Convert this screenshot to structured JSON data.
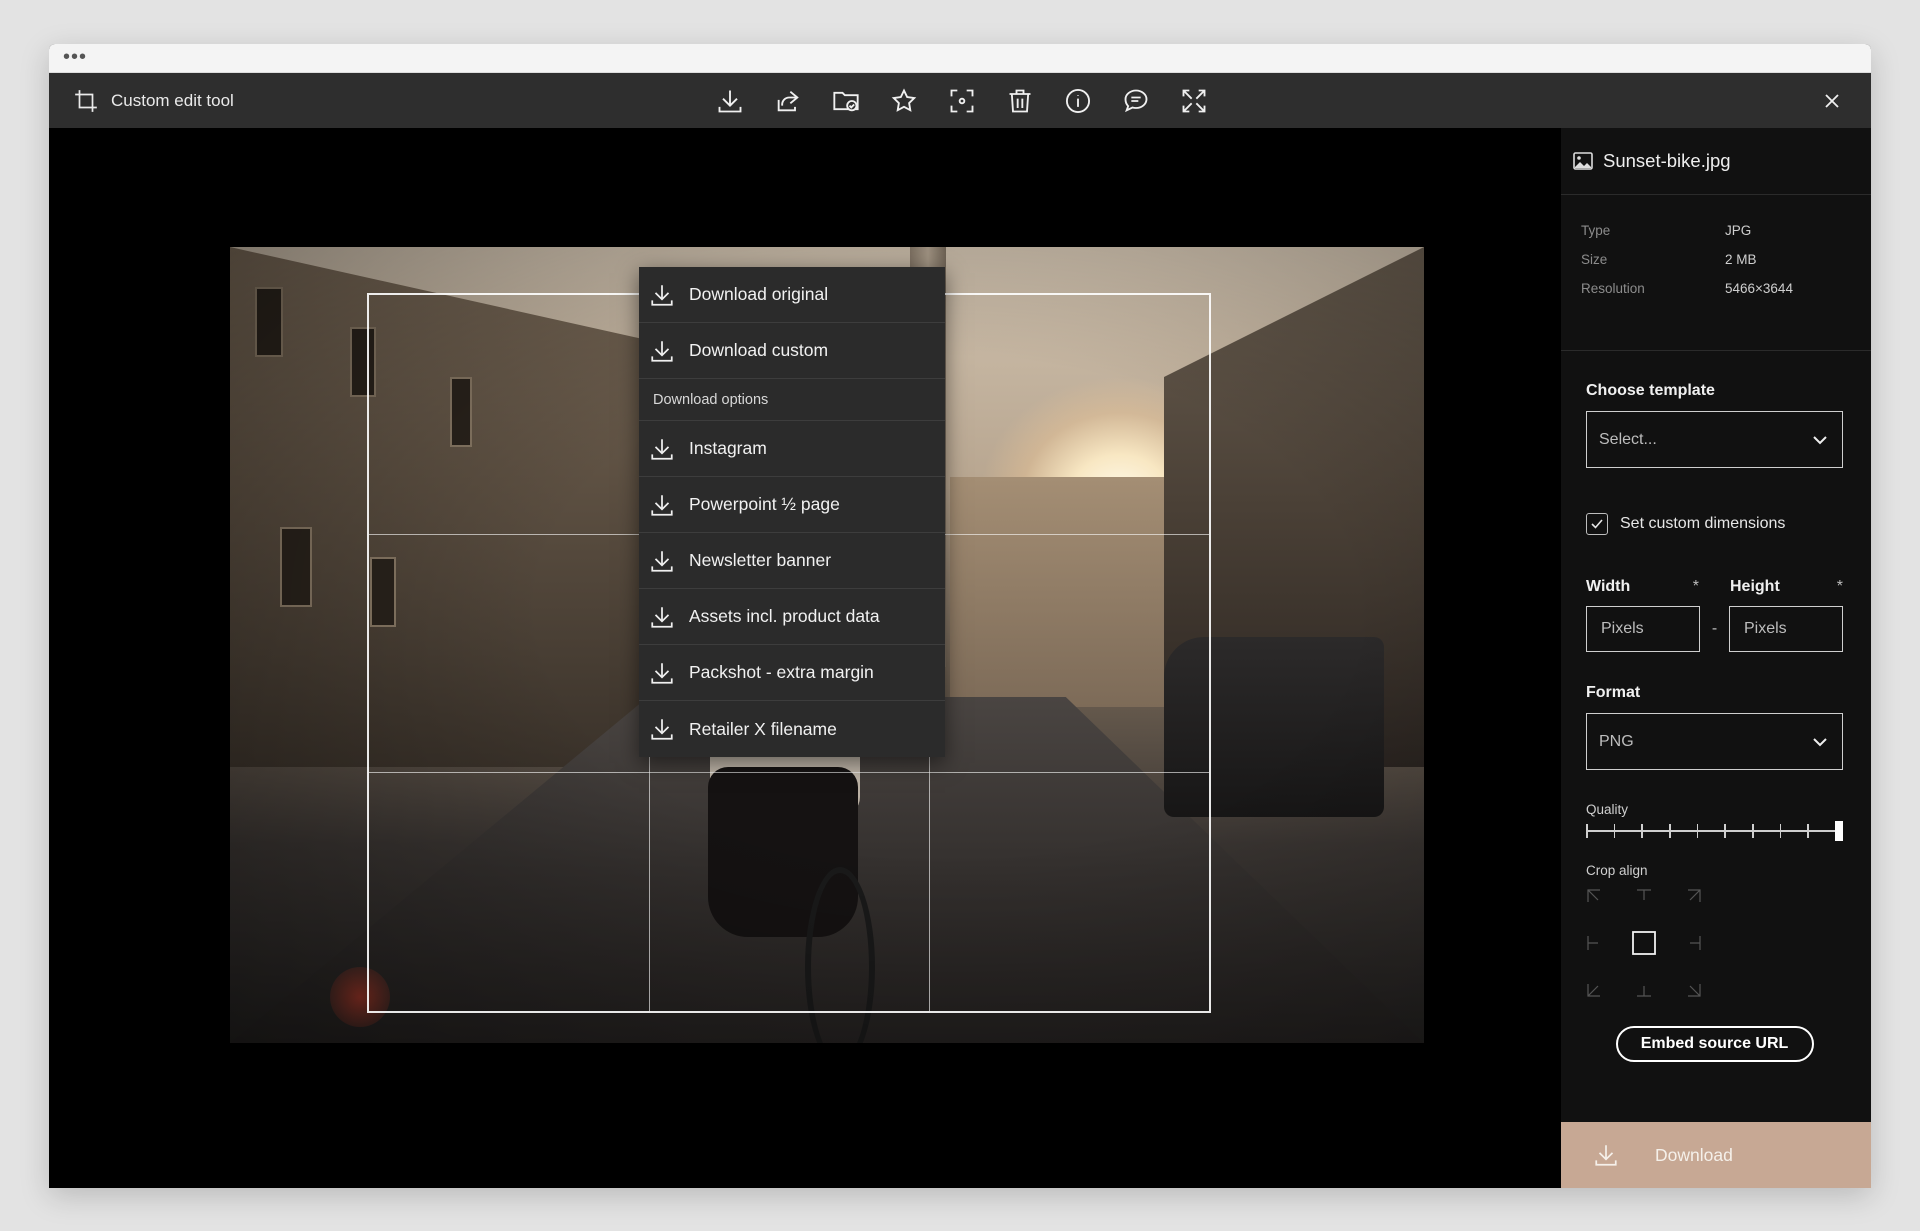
{
  "window": {
    "chrome_dots": "•••"
  },
  "toolbar": {
    "title": "Custom edit tool",
    "icons": [
      "download-icon",
      "share-icon",
      "folder-check-icon",
      "star-icon",
      "focus-icon",
      "trash-icon",
      "info-icon",
      "comment-icon",
      "expand-icon"
    ]
  },
  "download_menu": {
    "items": [
      "Download original",
      "Download custom"
    ],
    "section_label": "Download options",
    "options": [
      "Instagram",
      "Powerpoint ½ page",
      "Newsletter banner",
      "Assets incl. product data",
      "Packshot - extra margin",
      "Retailer X filename"
    ]
  },
  "sidebar": {
    "file_name": "Sunset-bike.jpg",
    "meta": [
      {
        "key": "Type",
        "value": "JPG"
      },
      {
        "key": "Size",
        "value": "2 MB"
      },
      {
        "key": "Resolution",
        "value": "5466×3644"
      }
    ],
    "template_label": "Choose template",
    "template_value": "Select...",
    "custom_dimensions_label": "Set custom dimensions",
    "custom_dimensions_checked": true,
    "width_label": "Width",
    "height_label": "Height",
    "required_mark": "*",
    "width_placeholder": "Pixels",
    "height_placeholder": "Pixels",
    "dim_separator": "-",
    "format_label": "Format",
    "format_value": "PNG",
    "quality_label": "Quality",
    "quality_level": 1.0,
    "crop_align_label": "Crop align",
    "crop_align_selected": "center",
    "embed_button": "Embed source URL",
    "download_button": "Download"
  },
  "colors": {
    "accent_download": "#c7a894",
    "toolbar_bg": "#2e2e2e",
    "sidebar_bg": "#111111"
  }
}
